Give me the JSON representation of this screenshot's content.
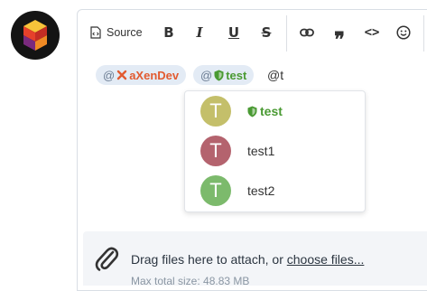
{
  "toolbar": {
    "source_label": "Source",
    "bold_label": "B",
    "italic_label": "I",
    "underline_label": "U",
    "strike_label": "S",
    "quote_label": "❞",
    "code_label": "<>",
    "icons": [
      "source-icon",
      "link-icon",
      "quote-icon",
      "code-icon",
      "smiley-icon"
    ]
  },
  "editor": {
    "mentions": [
      {
        "at": "@",
        "name": "aXenDev",
        "icon": "wrench-icon",
        "color": "#e25b31"
      },
      {
        "at": "@",
        "name": "test",
        "icon": "shield-icon",
        "color": "#4a9a33"
      }
    ],
    "typed_text": "@t"
  },
  "autocomplete": {
    "items": [
      {
        "initial": "T",
        "name": "test",
        "avatar_color": "#c4bf6a",
        "highlighted": true,
        "icon": "shield-icon"
      },
      {
        "initial": "T",
        "name": "test1",
        "avatar_color": "#b4636e",
        "highlighted": false
      },
      {
        "initial": "T",
        "name": "test2",
        "avatar_color": "#7cba6c",
        "highlighted": false
      }
    ]
  },
  "attachments": {
    "prefix": "Drag files here to attach, or ",
    "link": "choose files...",
    "icon": "paperclip-icon",
    "subtext": "Max total size: 48.83 MB"
  },
  "colors": {
    "accent": "#e25b31",
    "moderator_green": "#4a9a33",
    "mention_bg": "#e3ebf5"
  }
}
